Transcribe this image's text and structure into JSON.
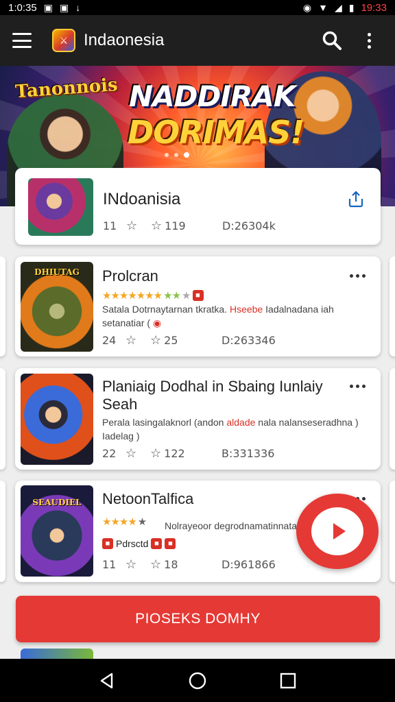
{
  "status_bar": {
    "time": "1:0:35",
    "right_time": "19:33"
  },
  "app_bar": {
    "title": "Indaonesia"
  },
  "banner": {
    "title_small": "Tanonnois",
    "title_line1": "NADDIRAK",
    "title_line2": "DORIMAS!",
    "dots": 3,
    "active_dot": 2
  },
  "featured": {
    "title": "INdoanisia",
    "stat_1": "11",
    "stat_2": "119",
    "stat_3": "D:26304k"
  },
  "cards": [
    {
      "title": "Prolcran",
      "thumb_label": "DHIUTAG",
      "rating_stars": 7,
      "rating_grey_stars": 3,
      "desc_before": "Satala Dotrnaytarnan tkratka. ",
      "desc_highlight": "Hseebe",
      "desc_after": " Iadalnadana iah setanatiar (",
      "stat_1": "24",
      "stat_2": "25",
      "stat_3": "D:263346"
    },
    {
      "title": "Planiaig Dodhal in Sbaing Iunlaiy Seah",
      "thumb_label": "",
      "desc_before": "Perala lasingalaknorl (andon ",
      "desc_highlight": "aldade",
      "desc_after": " nala nalanseseradhna ) Iadelag )",
      "stat_1": "22",
      "stat_2": "122",
      "stat_3": "B:331336"
    },
    {
      "title": "NetoonTalfica",
      "thumb_label": "SEAUDIEL",
      "rating_stars": 4,
      "rating_grey_stars": 1,
      "desc_before": "Nolrayeoor degrodnamatinnataniar",
      "desc_highlight": "",
      "desc_after": "",
      "sub_label": "Pdrsctd",
      "stat_1": "11",
      "stat_2": "18",
      "stat_3": "D:961866"
    }
  ],
  "cta": {
    "label": "PIOSEKS DOMHY"
  },
  "colors": {
    "accent": "#e53935",
    "app_bar": "#1f1f1f",
    "share": "#1565c0"
  }
}
